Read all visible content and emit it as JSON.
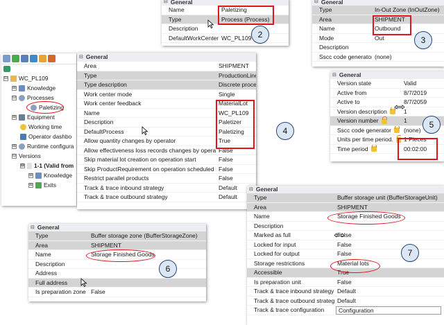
{
  "tree": {
    "toolbar_icons": [
      "edit-icon",
      "check-icon",
      "list-icon",
      "refresh-icon",
      "folder-icon",
      "export-icon"
    ],
    "nodes": [
      {
        "label": "WC_PL109",
        "icon": "work-center-icon",
        "expander": "⊟"
      },
      {
        "label": "Knowledge",
        "icon": "knowledge-icon",
        "expander": "⊞"
      },
      {
        "label": "Processes",
        "icon": "gear-icon",
        "expander": "⊟"
      },
      {
        "label": "Paletizing",
        "icon": "gear-icon",
        "expander": ""
      },
      {
        "label": "Equipment",
        "icon": "equipment-icon",
        "expander": "⊞"
      },
      {
        "label": "Working time",
        "icon": "clock-icon",
        "expander": ""
      },
      {
        "label": "Operator dashbo",
        "icon": "dashboard-icon",
        "expander": ""
      },
      {
        "label": "Runtime configura",
        "icon": "gear-icon",
        "expander": "⊞"
      },
      {
        "label": "Versions",
        "icon": "",
        "expander": "⊟"
      },
      {
        "label": "1-1 (Valid from",
        "icon": "",
        "expander": "⊟"
      },
      {
        "label": "Knowledge",
        "icon": "knowledge-icon",
        "expander": "⊞"
      },
      {
        "label": "Exits",
        "icon": "exit-icon",
        "expander": "⊞"
      }
    ]
  },
  "panel2": {
    "header": "General",
    "rows": [
      {
        "key": "Name",
        "value": "Paletizing"
      },
      {
        "key": "Type",
        "value": "Process (Process)"
      },
      {
        "key": "Description",
        "value": ""
      },
      {
        "key": "DefaultWorkCenter",
        "value": "WC_PL109"
      }
    ],
    "badge": "2"
  },
  "panel3": {
    "header": "General",
    "rows": [
      {
        "key": "Type",
        "value": "In-Out Zone (InOutZone)"
      },
      {
        "key": "Area",
        "value": "SHIPMENT"
      },
      {
        "key": "Name",
        "value": "Outbound"
      },
      {
        "key": "Mode",
        "value": "Out"
      },
      {
        "key": "Description",
        "value": ""
      },
      {
        "key": "Sscc code generator",
        "value": "(none)"
      }
    ],
    "badge": "3"
  },
  "panel4": {
    "header": "General",
    "rows": [
      {
        "key": "Area",
        "value": "SHIPMENT"
      },
      {
        "key": "Type",
        "value": "ProductionLine (ProductionLine)"
      },
      {
        "key": "Type description",
        "value": "Discrete process"
      },
      {
        "key": "Work center mode",
        "value": "Single"
      },
      {
        "key": "Work center feedback",
        "value": "MaterialLot"
      },
      {
        "key": "Name",
        "value": "WC_PL109"
      },
      {
        "key": "Description",
        "value": "Paletizer"
      },
      {
        "key": "DefaultProcess",
        "value": "Paletizing"
      },
      {
        "key": "Allow quantity changes by operator",
        "value": "True"
      },
      {
        "key": "Allow effectiveness loss records changes by operator",
        "value": "False"
      },
      {
        "key": "Skip material lot creation on operation start",
        "value": "False"
      },
      {
        "key": "Skip ProductRequirement on operation scheduled",
        "value": "False"
      },
      {
        "key": "Restrict parallel products",
        "value": "False"
      },
      {
        "key": "Track & trace inbound strategy",
        "value": "Default"
      },
      {
        "key": "Track & trace outbound strategy",
        "value": "Default"
      }
    ],
    "badge": "4"
  },
  "panel5": {
    "header": "General",
    "rows": [
      {
        "key": "Version state",
        "value": "Valid"
      },
      {
        "key": "Active from",
        "value": "8/7/2019"
      },
      {
        "key": "Active to",
        "value": "8/7/2059"
      },
      {
        "key": "Version description",
        "value": "1"
      },
      {
        "key": "Version number",
        "value": "1"
      },
      {
        "key": "Sscc code generator",
        "value": "(none)"
      },
      {
        "key": "Units per time period.",
        "value": "1 Pieces"
      },
      {
        "key": "Time period",
        "value": "00:02:00"
      }
    ],
    "badge": "5"
  },
  "panel6": {
    "header": "General",
    "rows": [
      {
        "key": "Type",
        "value": "Buffer storage zone (BufferStorageZone)"
      },
      {
        "key": "Area",
        "value": "SHIPMENT"
      },
      {
        "key": "Name",
        "value": "Storage Finished Goods"
      },
      {
        "key": "Description",
        "value": ""
      },
      {
        "key": "Address",
        "value": ""
      },
      {
        "key": "Full address",
        "value": ""
      },
      {
        "key": "Is preparation zone",
        "value": "False"
      }
    ],
    "badge": "6"
  },
  "panel7": {
    "header": "General",
    "rows": [
      {
        "key": "Type",
        "value": "Buffer storage unit (BufferStorageUnit)"
      },
      {
        "key": "Area",
        "value": "SHIPMENT"
      },
      {
        "key": "Name",
        "value": "Storage Finished Goods"
      },
      {
        "key": "Description",
        "value": ""
      },
      {
        "key": "Marked as full",
        "value": "False"
      },
      {
        "key": "Locked for input",
        "value": "False"
      },
      {
        "key": "Locked for output",
        "value": "False"
      },
      {
        "key": "Storage restrictions",
        "value": "Material lots"
      },
      {
        "key": "Accessible",
        "value": "True"
      },
      {
        "key": "Is preparation unit",
        "value": "False"
      },
      {
        "key": "Track & trace inbound strategy",
        "value": "Default"
      },
      {
        "key": "Track & trace outbound strategy",
        "value": "Default"
      },
      {
        "key": "Track & trace configuration",
        "value": "Configuration"
      }
    ],
    "badge": "7"
  }
}
